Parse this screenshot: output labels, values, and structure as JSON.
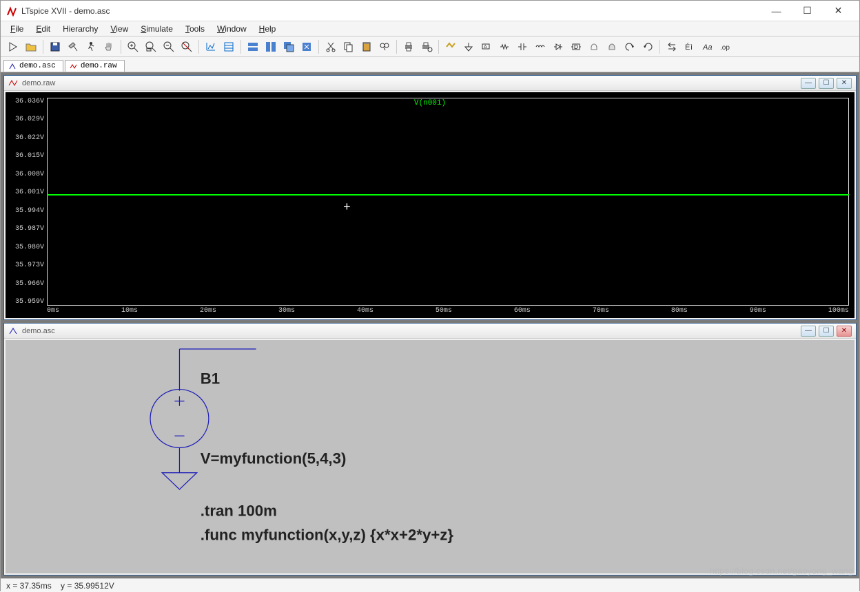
{
  "app": {
    "title": "LTspice XVII - demo.asc"
  },
  "menu": {
    "items": [
      "File",
      "Edit",
      "Hierarchy",
      "View",
      "Simulate",
      "Tools",
      "Window",
      "Help"
    ]
  },
  "toolbar_icons": [
    "run-icon",
    "open-icon",
    "save-icon",
    "hammer-icon",
    "runner-icon",
    "hand-pan-icon",
    "zoom-in-icon",
    "zoom-out-icon",
    "zoom-fit-icon",
    "zoom-reset-icon",
    "autorange-icon",
    "settings-icon",
    "tile-horz-icon",
    "tile-vert-icon",
    "cascade-icon",
    "close-win-icon",
    "cut-icon",
    "copy-icon",
    "paste-icon",
    "find-icon",
    "print-icon",
    "print-setup-icon",
    "wire-icon",
    "ground-icon",
    "label-icon",
    "resistor-icon",
    "capacitor-icon",
    "inductor-icon",
    "diode-icon",
    "component-icon",
    "move-icon",
    "drag-icon",
    "undo-icon",
    "redo-icon",
    "rotate-icon",
    "mirror-icon",
    "text-icon",
    "spice-directive-icon"
  ],
  "tabs": [
    {
      "label": "demo.asc",
      "icon": "schematic-icon"
    },
    {
      "label": "demo.raw",
      "icon": "waveform-icon"
    }
  ],
  "raw_window": {
    "title": "demo.raw",
    "trace_label": "V(n001)"
  },
  "asc_window": {
    "title": "demo.asc",
    "b1_label": "B1",
    "b1_value": "V=myfunction(5,4,3)",
    "tran": ".tran 100m",
    "func": ".func myfunction(x,y,z) {x*x+2*y+z}"
  },
  "chart_data": {
    "type": "line",
    "title": "V(n001)",
    "xlabel": "",
    "ylabel": "",
    "x_unit": "ms",
    "y_unit": "V",
    "x_ticks": [
      "0ms",
      "10ms",
      "20ms",
      "30ms",
      "40ms",
      "50ms",
      "60ms",
      "70ms",
      "80ms",
      "90ms",
      "100ms"
    ],
    "y_ticks": [
      "36.036V",
      "36.029V",
      "36.022V",
      "36.015V",
      "36.008V",
      "36.001V",
      "35.994V",
      "35.987V",
      "35.980V",
      "35.973V",
      "35.966V",
      "35.959V"
    ],
    "xlim": [
      0,
      100
    ],
    "ylim": [
      35.959,
      36.036
    ],
    "series": [
      {
        "name": "V(n001)",
        "color": "#00ff00",
        "x": [
          0,
          100
        ],
        "y": [
          36.001,
          36.001
        ]
      }
    ],
    "cursor": {
      "x_ms": 37.35,
      "y_V": 35.99512
    }
  },
  "status": {
    "x_label": "x = 37.35ms",
    "gap": "     ",
    "y_label": "y = 35.99512V"
  },
  "watermark": "https://blog.csdn.net/gaoyong_wang"
}
